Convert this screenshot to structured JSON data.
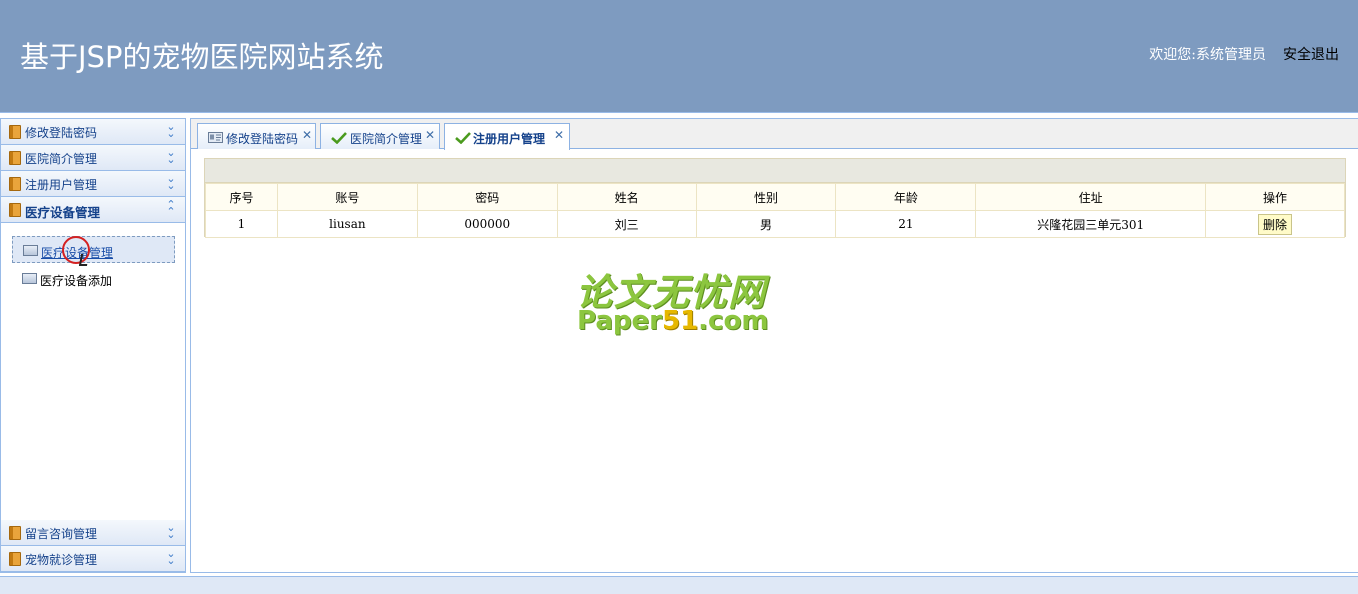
{
  "header": {
    "title": "基于JSP的宠物医院网站系统",
    "welcome": "欢迎您:系统管理员",
    "logout": "安全退出",
    "bg_color": "#7e9bc0"
  },
  "sidebar": {
    "sections": [
      {
        "label": "修改登陆密码",
        "icon": "folder-icon"
      },
      {
        "label": "医院简介管理",
        "icon": "folder-icon"
      },
      {
        "label": "注册用户管理",
        "icon": "folder-icon"
      },
      {
        "label": "医疗设备管理",
        "icon": "folder-icon",
        "expanded": true
      },
      {
        "label": "留言咨询管理",
        "icon": "folder-icon"
      },
      {
        "label": "宠物就诊管理",
        "icon": "folder-icon"
      }
    ],
    "tree_items": [
      {
        "label": "医疗设备管理",
        "selected": true
      },
      {
        "label": "医疗设备添加",
        "selected": false
      }
    ]
  },
  "tabs": [
    {
      "label": "修改登陆密码",
      "icon": "id-card-icon"
    },
    {
      "label": "医院简介管理",
      "icon": "check-icon"
    },
    {
      "label": "注册用户管理",
      "icon": "check-icon",
      "active": true
    }
  ],
  "table": {
    "columns": [
      "序号",
      "账号",
      "密码",
      "姓名",
      "性别",
      "年龄",
      "住址",
      "操作"
    ],
    "rows": [
      [
        "1",
        "liusan",
        "000000",
        "刘三",
        "男",
        "21",
        "兴隆花园三单元301",
        "删除"
      ]
    ]
  },
  "watermark": {
    "cn": "论文无忧网",
    "en_pre": "Paper",
    "en_hi": "51",
    "en_post": ".com"
  }
}
